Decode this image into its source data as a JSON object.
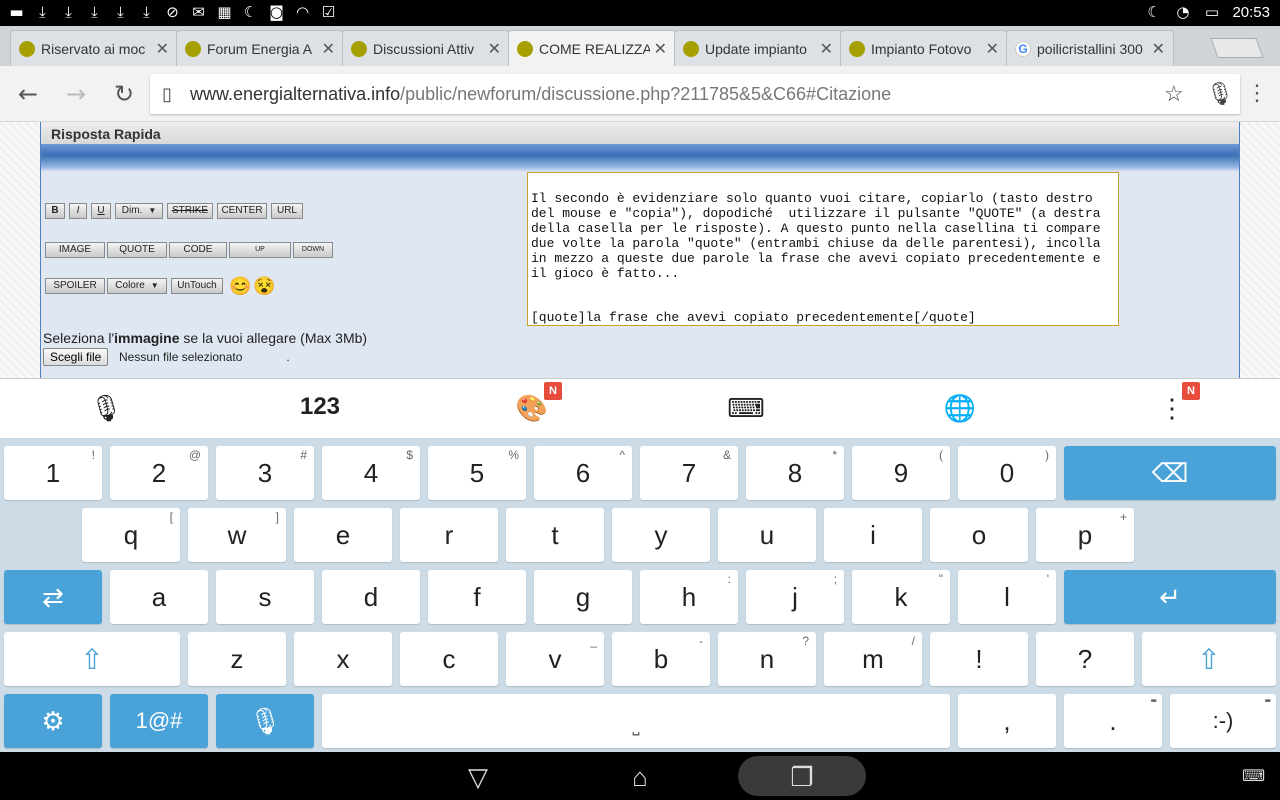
{
  "status_bar": {
    "time": "20:53",
    "left_icons": [
      "notification-icon",
      "download-icon",
      "download-icon",
      "download-icon",
      "download-icon",
      "download-icon",
      "blocked-icon",
      "mail-icon",
      "image-icon",
      "moon-icon",
      "app-icon",
      "wifi-hotspot-icon",
      "clipboard-check-icon"
    ],
    "right_icons": [
      "moon-icon",
      "wifi-icon",
      "battery-icon"
    ]
  },
  "tabs": [
    {
      "title": "Riservato ai moc",
      "favicon": "forum"
    },
    {
      "title": "Forum Energia A",
      "favicon": "forum"
    },
    {
      "title": "Discussioni Attiv",
      "favicon": "forum"
    },
    {
      "title": "COME REALIZZA",
      "favicon": "forum",
      "active": true
    },
    {
      "title": "Update impianto",
      "favicon": "forum"
    },
    {
      "title": "Impianto Fotovo",
      "favicon": "forum"
    },
    {
      "title": "poilicristallini 300",
      "favicon": "google"
    }
  ],
  "toolbar": {
    "url_domain": "www.energialternativa.info",
    "url_path": "/public/newforum/discussione.php?211785&5&C66#Citazione"
  },
  "page": {
    "panel_title": "Risposta Rapida",
    "format_row1": [
      "B",
      "I",
      "U",
      "Dim.",
      "STRIKE",
      "CENTER",
      "URL"
    ],
    "format_row2": [
      "IMAGE",
      "QUOTE",
      "CODE",
      "UP",
      "DOWN"
    ],
    "format_row3": [
      "SPOILER",
      "Colore",
      "UnTouch"
    ],
    "textarea_body": "Il secondo è evidenziare solo quanto vuoi citare, copiarlo (tasto destro del mouse e \"copia\"), dopodiché  utilizzare il pulsante \"QUOTE\" (a destra della casella per le risposte). A questo punto nella casellina ti compare due volte la parola \"quote\" (entrambi chiuse da delle parentesi), incolla in mezzo a queste due parole la frase che avevi copiato precedentemente e il gioco è fatto...",
    "textarea_quote_line": "[quote]la frase che avevi copiato precedentemente[/quote]",
    "attach_label_pre": "Seleziona l'",
    "attach_label_bold": "immagine",
    "attach_label_post": " se la vuoi allegare (Max 3Mb)",
    "file_button": "Scegli file",
    "file_status": "Nessun file selezionato",
    "file_dot": "."
  },
  "keyboard_toolbar": {
    "numbers_label": "123",
    "badge": "N"
  },
  "keyboard": {
    "row1": [
      [
        "1",
        "!"
      ],
      [
        "2",
        "@"
      ],
      [
        "3",
        "#"
      ],
      [
        "4",
        "$"
      ],
      [
        "5",
        "%"
      ],
      [
        "6",
        "^"
      ],
      [
        "7",
        "&"
      ],
      [
        "8",
        "*"
      ],
      [
        "9",
        "("
      ],
      [
        "0",
        ")"
      ]
    ],
    "row2": [
      [
        "q",
        "["
      ],
      [
        "w",
        "]"
      ],
      [
        "e",
        ""
      ],
      [
        "r",
        ""
      ],
      [
        "t",
        ""
      ],
      [
        "y",
        ""
      ],
      [
        "u",
        ""
      ],
      [
        "i",
        ""
      ],
      [
        "o",
        ""
      ],
      [
        "p",
        "+"
      ]
    ],
    "row3": [
      [
        "a",
        ""
      ],
      [
        "s",
        ""
      ],
      [
        "d",
        ""
      ],
      [
        "f",
        ""
      ],
      [
        "g",
        ""
      ],
      [
        "h",
        ":"
      ],
      [
        "j",
        ";"
      ],
      [
        "k",
        "\""
      ],
      [
        "l",
        "'"
      ]
    ],
    "row4": [
      [
        "z",
        ""
      ],
      [
        "x",
        ""
      ],
      [
        "c",
        ""
      ],
      [
        "v",
        "_"
      ],
      [
        "b",
        "-"
      ],
      [
        "n",
        "?"
      ],
      [
        "m",
        "/"
      ],
      [
        "!",
        ""
      ],
      [
        "?",
        ""
      ]
    ],
    "symbols_label": "1@#",
    "comma": ",",
    "period": ".",
    "emoticon": ":-)",
    "more_dots": "•••"
  },
  "colors": {
    "accent_blue": "#4aa3d8",
    "keyboard_bg": "#cddbe6",
    "panel_bg": "#dfe7f2"
  }
}
